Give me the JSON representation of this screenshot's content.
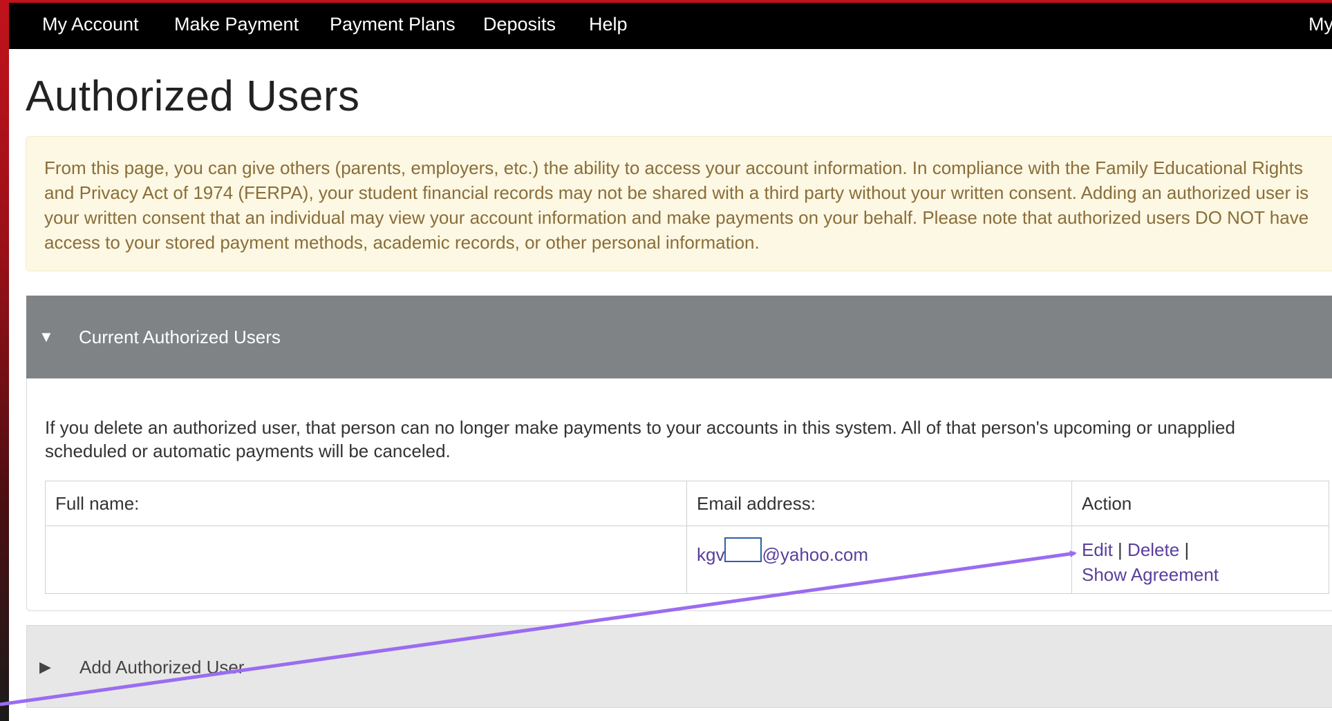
{
  "nav": {
    "items": [
      {
        "label": "My Account"
      },
      {
        "label": "Make Payment"
      },
      {
        "label": "Payment Plans"
      },
      {
        "label": "Deposits"
      },
      {
        "label": "Help"
      }
    ],
    "right_label": "My"
  },
  "page": {
    "title": "Authorized Users",
    "info_text": "From this page, you can give others (parents, employers, etc.) the ability to access your account information. In compliance with the Family Educational Rights and Privacy Act of 1974 (FERPA), your student financial records may not be shared with a third party without your written consent. Adding an authorized user is your written consent that an individual may view your account information and make payments on your behalf. Please note that authorized users DO NOT have access to your stored payment methods, academic records, or other personal information."
  },
  "current_panel": {
    "arrow": "▼",
    "title": "Current Authorized Users",
    "note": "If you delete an authorized user, that person can no longer make payments to your accounts in this system. All of that person's upcoming or unapplied scheduled or automatic payments will be canceled.",
    "table": {
      "headers": [
        "Full name:",
        "Email address:",
        "Action"
      ],
      "rows": [
        {
          "full_name": "",
          "email_prefix": "kgv",
          "email_suffix": "@yahoo.com",
          "action_edit": "Edit",
          "action_delete": "Delete",
          "separator": "|",
          "action_agreement": "Show Agreement"
        }
      ]
    }
  },
  "add_panel": {
    "arrow": "▶",
    "title": "Add Authorized User"
  },
  "annotation": {
    "arrow_color": "#9b6cf0"
  }
}
